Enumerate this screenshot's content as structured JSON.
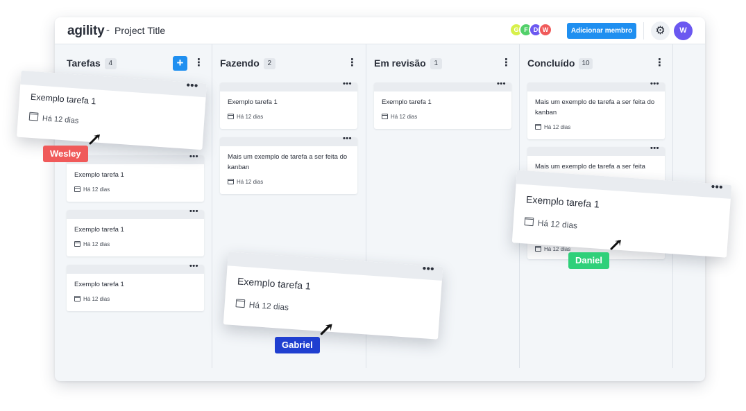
{
  "app": {
    "logo": "agility",
    "separator": "-",
    "project_title": "Project Title",
    "add_member_label": "Adicionar membro",
    "user_initial": "W",
    "members": [
      {
        "initial": "G",
        "color": "#d7f04a"
      },
      {
        "initial": "F",
        "color": "#52d06a"
      },
      {
        "initial": "D",
        "color": "#6b58f0"
      },
      {
        "initial": "W",
        "color": "#f05a5a"
      }
    ]
  },
  "columns": [
    {
      "title": "Tarefas",
      "count": "4",
      "has_add": true,
      "add_label": "+",
      "more": "⋮"
    },
    {
      "title": "Fazendo",
      "count": "2",
      "has_add": false,
      "more": "⋮"
    },
    {
      "title": "Em revisão",
      "count": "1",
      "has_add": false,
      "more": "⋮"
    },
    {
      "title": "Concluído",
      "count": "10",
      "has_add": false,
      "more": "⋮"
    }
  ],
  "cards": {
    "tarefas": [
      {
        "title": "Exemplo tarefa 1",
        "date": "Há 12 dias"
      },
      {
        "title": "Exemplo tarefa 1",
        "date": "Há 12 dias"
      },
      {
        "title": "Exemplo tarefa 1",
        "date": "Há 12 dias"
      }
    ],
    "fazendo": [
      {
        "title": "Exemplo tarefa 1",
        "date": "Há 12 dias"
      },
      {
        "title": "Mais um exemplo de tarefa a ser feita do kanban",
        "date": "Há 12 dias"
      }
    ],
    "revisao": [
      {
        "title": "Exemplo tarefa 1",
        "date": "Há 12 dias"
      }
    ],
    "concluido": [
      {
        "title": "Mais um exemplo de tarefa a ser feita do kanban",
        "date": "Há 12 dias"
      },
      {
        "title": "Mais um exemplo de tarefa a ser feita",
        "date": "Há 12 dias"
      }
    ]
  },
  "dragging": [
    {
      "title": "Exemplo tarefa 1",
      "date": "Há 12 dias",
      "user": "Wesley",
      "color": "#f05a5a"
    },
    {
      "title": "Exemplo tarefa 1",
      "date": "Há 12 dias",
      "user": "Gabriel",
      "color": "#1f3fd0"
    },
    {
      "title": "Exemplo tarefa 1",
      "date": "Há 12 dias",
      "user": "Daniel",
      "color": "#2fd07a"
    }
  ],
  "card_menu": "•••"
}
